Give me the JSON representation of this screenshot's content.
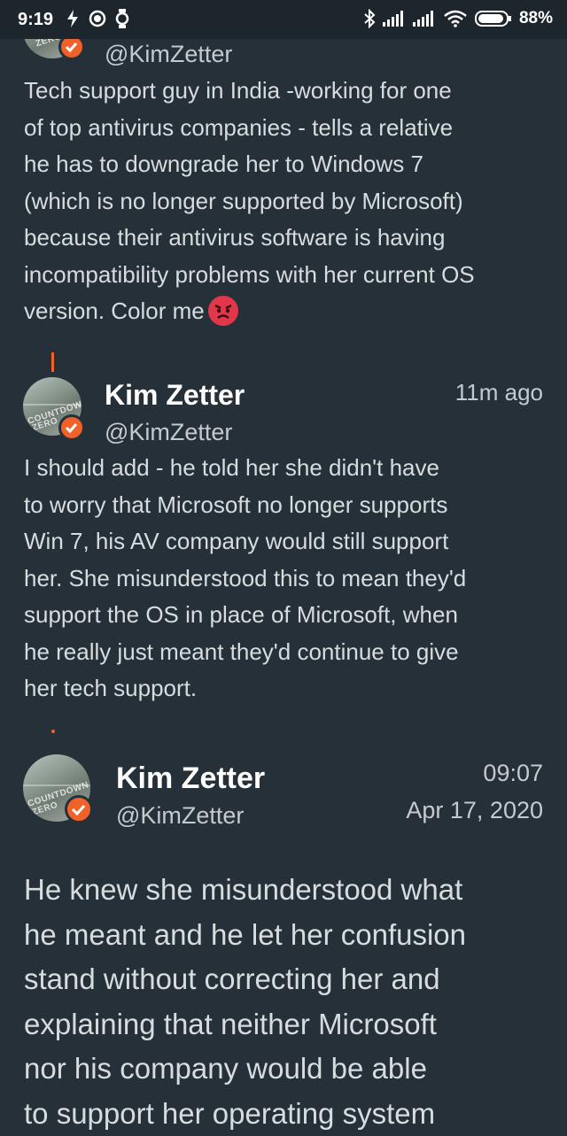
{
  "status_bar": {
    "time": "9:19",
    "battery": "88%",
    "icons": [
      "flash-icon",
      "record-icon",
      "watch-icon",
      "bluetooth-icon",
      "signal-icon",
      "signal-icon",
      "wifi-icon",
      "battery-icon"
    ]
  },
  "tweets": [
    {
      "handle": "@KimZetter",
      "text": "Tech support guy in India -working for one\nof top antivirus companies - tells a relative\nhe has to downgrade her to Windows 7\n(which is no longer supported by Microsoft)\nbecause their antivirus software is having\nincompatibility problems with her current OS\nversion. Color me",
      "emoji": "angry-face-emoji"
    },
    {
      "name": "Kim Zetter",
      "handle": "@KimZetter",
      "time": "11m ago",
      "text": "I should add - he told her she didn't have\nto worry that Microsoft no longer supports\nWin 7, his AV company would still support\nher. She misunderstood this to mean they'd\nsupport the OS in place of Microsoft, when\nhe really just meant they'd continue to give\nher tech support."
    },
    {
      "name": "Kim Zetter",
      "handle": "@KimZetter",
      "time": "09:07",
      "date": "Apr 17, 2020",
      "text": "He knew she misunderstood what\nhe meant and he let her confusion\nstand without correcting her and\nexplaining that neither Microsoft\nnor his company would be able\nto support her operating system"
    }
  ],
  "colors": {
    "background": "#263038",
    "accent": "#f0622a",
    "text": "#d7dcdf"
  }
}
